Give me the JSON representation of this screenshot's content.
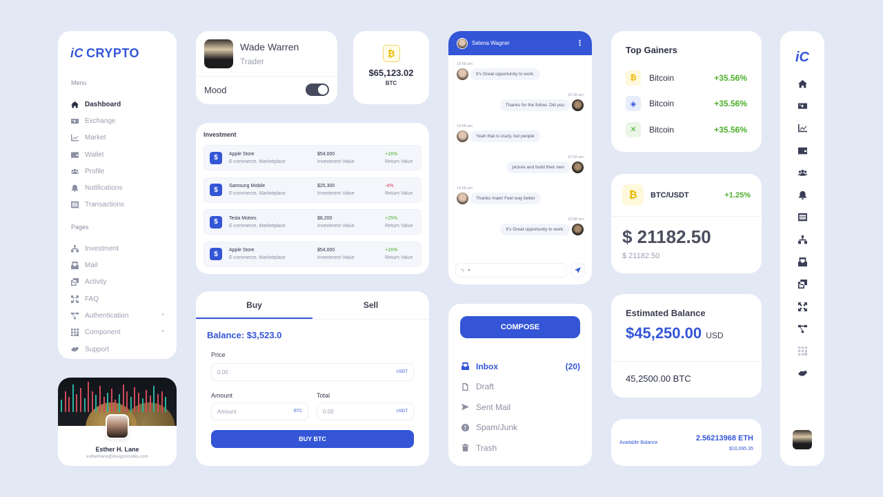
{
  "brand": {
    "logo_mark": "iC",
    "logo_text": "CRYPTO",
    "accent": "#3355d6"
  },
  "sidebar": {
    "menu_label": "Menu",
    "menu_items": [
      {
        "label": "Dashboard",
        "icon": "home-icon",
        "active": true
      },
      {
        "label": "Exchange",
        "icon": "exchange-icon"
      },
      {
        "label": "Market",
        "icon": "chart-line-icon"
      },
      {
        "label": "Wallet",
        "icon": "wallet-icon"
      },
      {
        "label": "Profile",
        "icon": "users-icon"
      },
      {
        "label": "Notifications",
        "icon": "bell-icon"
      },
      {
        "label": "Transactions",
        "icon": "list-icon"
      }
    ],
    "pages_label": "Pages",
    "page_items": [
      {
        "label": "Investment",
        "icon": "sitemap-icon"
      },
      {
        "label": "Mail",
        "icon": "mail-icon"
      },
      {
        "label": "Activity",
        "icon": "images-icon"
      },
      {
        "label": "FAQ",
        "icon": "expand-icon"
      },
      {
        "label": "Authentication",
        "icon": "nodes-icon",
        "chevron": "^"
      },
      {
        "label": "Component",
        "icon": "grid-icon",
        "chevron": "^"
      },
      {
        "label": "Support",
        "icon": "handshake-icon"
      }
    ]
  },
  "profile_card": {
    "name": "Esther H. Lane",
    "email": "estherhlane@designtocodes.com"
  },
  "trader_card": {
    "name": "Wade Warren",
    "role": "Trader",
    "mood_label": "Mood",
    "mood_on": true
  },
  "btc_card": {
    "symbol": "₿",
    "value": "$65,123.02",
    "code": "BTC"
  },
  "investment": {
    "title": "Investment",
    "rows": [
      {
        "name": "Apple Store",
        "category": "E-commerce, Marketplace",
        "value": "$54,000",
        "value_label": "Investment Value",
        "return": "+16%",
        "return_label": "Return Value",
        "positive": true
      },
      {
        "name": "Samsung Mobile",
        "category": "E-commerce, Marketplace",
        "value": "$25,300",
        "value_label": "Investment Value",
        "return": "-4%",
        "return_label": "Return Value",
        "positive": false
      },
      {
        "name": "Tesla Motors",
        "category": "E-commerce, Marketplace",
        "value": "$8,200",
        "value_label": "Investment Value",
        "return": "+25%",
        "return_label": "Return Value",
        "positive": true
      },
      {
        "name": "Apple Store",
        "category": "E-commerce, Marketplace",
        "value": "$54,000",
        "value_label": "Investment Value",
        "return": "+16%",
        "return_label": "Return Value",
        "positive": true
      }
    ],
    "icon_symbol": "$"
  },
  "trade": {
    "tabs": [
      "Buy",
      "Sell"
    ],
    "active_tab": "Buy",
    "balance": "Balance: $3,523.0",
    "price_label": "Price",
    "price_placeholder": "0.00",
    "price_unit": "USDT",
    "amount_label": "Amount",
    "amount_placeholder": "Amount",
    "amount_unit": "BTC",
    "total_label": "Total",
    "total_placeholder": "0.00",
    "total_unit": "USDT",
    "button": "BUY BTC"
  },
  "chat": {
    "contact": "Selena Wagner",
    "menu_icon": "⋮",
    "messages": [
      {
        "side": "left",
        "time": "10:58 am",
        "text": "It's Great opportunity to work."
      },
      {
        "side": "right",
        "time": "10:58 am",
        "text": "Thanks for the follow. Did you"
      },
      {
        "side": "left",
        "time": "10:58 am",
        "text": "Yeah that is crazy, but people"
      },
      {
        "side": "right",
        "time": "10:58 am",
        "text": "picture and build their own"
      },
      {
        "side": "left",
        "time": "10:58 am",
        "text": "Thanks mate! Feel way better"
      },
      {
        "side": "right",
        "time": "10:58 am",
        "text": "It's Great opportunity to work."
      }
    ]
  },
  "mail": {
    "compose": "COMPOSE",
    "items": [
      {
        "label": "Inbox",
        "count": "(20)",
        "icon": "inbox-icon",
        "active": true
      },
      {
        "label": "Draft",
        "icon": "file-icon"
      },
      {
        "label": "Sent Mail",
        "icon": "send-icon"
      },
      {
        "label": "Spam/Junk",
        "icon": "alert-icon"
      },
      {
        "label": "Trash",
        "icon": "trash-icon"
      }
    ]
  },
  "top_gainers": {
    "title": "Top Gainers",
    "rows": [
      {
        "name": "Bitcoin",
        "change": "+35.56%",
        "icon": "bitcoin-icon",
        "glyph": "₿",
        "color": "#e9b900",
        "bg": "#fff8da"
      },
      {
        "name": "Bitcoin",
        "change": "+35.56%",
        "icon": "binance-icon",
        "glyph": "◈",
        "color": "#3355d6",
        "bg": "#e8edfb"
      },
      {
        "name": "Bitcoin",
        "change": "+35.56%",
        "icon": "x-coin-icon",
        "glyph": "✕",
        "color": "#4caf2b",
        "bg": "#eaf6e6"
      }
    ]
  },
  "pair": {
    "name": "BTC/USDT",
    "change": "+1.25%",
    "glyph": "₿",
    "price": "$ 21182.50",
    "sub_price": "$ 21182.50"
  },
  "estimated": {
    "title": "Estimated Balance",
    "value": "$45,250.00",
    "unit": "USD",
    "btc": "45,2500.00 BTC"
  },
  "available": {
    "label": "Available Balance",
    "eth": "2.56213968 ETH",
    "usd": "$10,095.35"
  },
  "rail": {
    "logo": "iC"
  },
  "colors": {
    "positive": "#4caf2b",
    "negative": "#e03c5d",
    "background": "#e3e8f5"
  }
}
